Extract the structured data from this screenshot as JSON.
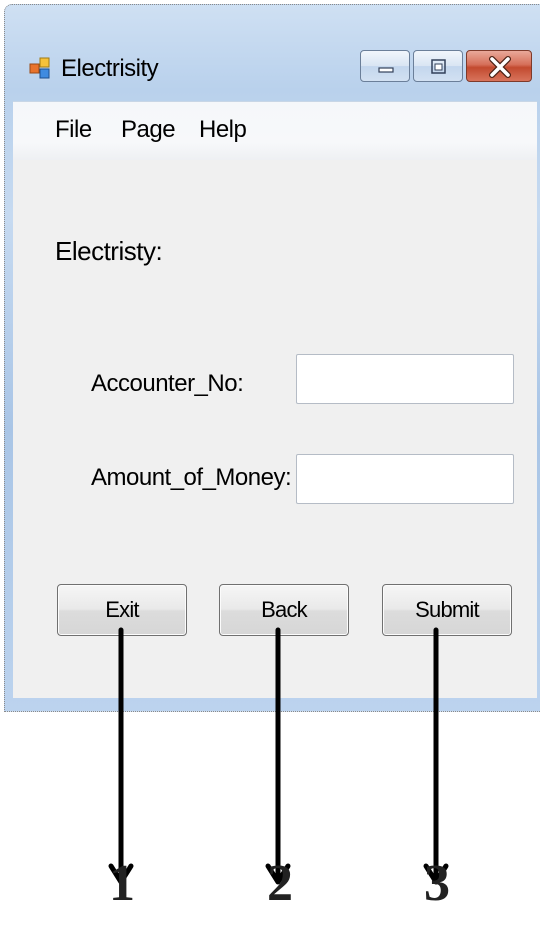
{
  "window": {
    "title": "Electrisity",
    "controls": [
      "minimize-icon",
      "maximize-icon",
      "close-icon"
    ]
  },
  "menu": {
    "file": "File",
    "page": "Page",
    "help": "Help"
  },
  "form": {
    "heading": "Electristy:",
    "accounter_label": "Accounter_No:",
    "accounter_value": "",
    "amount_label": "Amount_of_Money:",
    "amount_value": ""
  },
  "buttons": {
    "exit": "Exit",
    "back": "Back",
    "submit": "Submit"
  },
  "annotations": {
    "labels": [
      "1",
      "2",
      "3"
    ]
  },
  "colors": {
    "close_button": "#c24a2f",
    "frame": "#b9d1ec",
    "client": "#f0f0f0"
  }
}
